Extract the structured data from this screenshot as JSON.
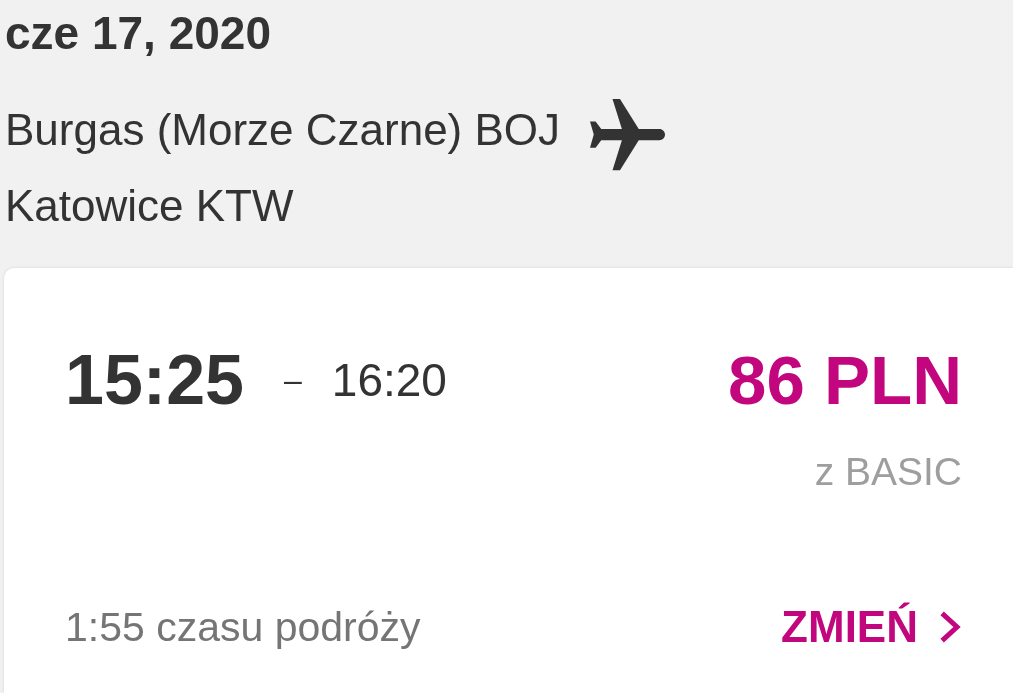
{
  "header": {
    "date": "cze 17, 2020",
    "origin": "Burgas (Morze Czarne) BOJ",
    "destination": "Katowice KTW"
  },
  "flight": {
    "departure": "15:25",
    "separator": "–",
    "arrival": "16:20",
    "price": "86 PLN",
    "fare": "z BASIC",
    "duration": "1:55 czasu podróży",
    "change_button": "ZMIEŃ"
  }
}
